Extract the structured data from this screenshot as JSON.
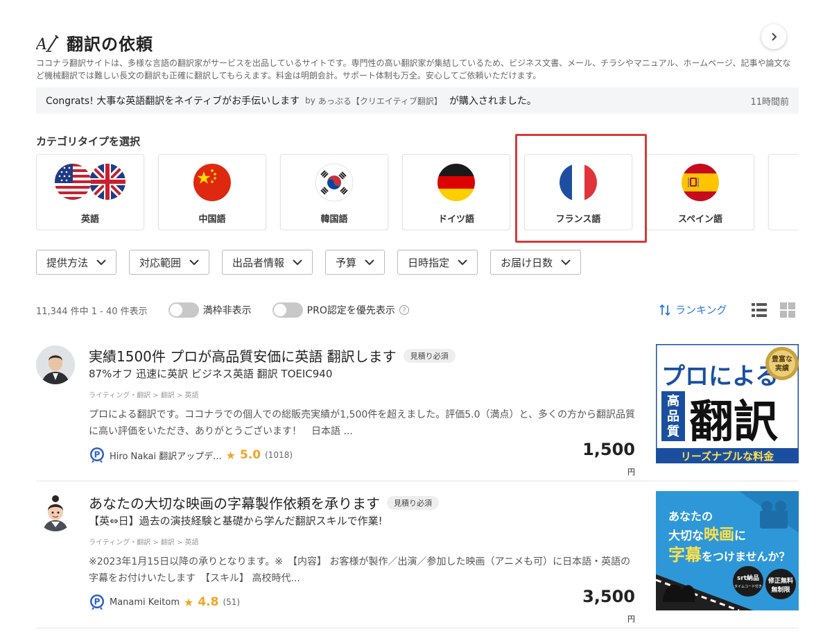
{
  "header": {
    "title": "翻訳の依頼",
    "description": "ココナラ翻訳サイトは、多様な言語の翻訳家がサービスを出品しているサイトです。専門性の高い翻訳家が集結しているため、ビジネス文書、メール、チラシやマニュアル、ホームページ、記事や論文など機械翻訳では難しい長文の翻訳も正確に翻訳してもらえます。料金は明朗会計。サポート体制も万全。安心してご依頼いただけます。"
  },
  "congrats": {
    "message": "Congrats! 大事な英語翻訳をネイティブがお手伝いします",
    "by": "by",
    "seller": "あっぷる【クリエイティブ翻訳】",
    "suffix": "が購入されました。",
    "time": "11時間前"
  },
  "categories": {
    "heading": "カテゴリタイプを選択",
    "items": [
      {
        "label": "英語",
        "icon": "us-uk-flag-icon"
      },
      {
        "label": "中国語",
        "icon": "china-flag-icon"
      },
      {
        "label": "韓国語",
        "icon": "korea-flag-icon"
      },
      {
        "label": "ドイツ語",
        "icon": "germany-flag-icon"
      },
      {
        "label": "フランス語",
        "icon": "france-flag-icon"
      },
      {
        "label": "スペイン語",
        "icon": "spain-flag-icon"
      }
    ]
  },
  "filters": [
    "提供方法",
    "対応範囲",
    "出品者情報",
    "予算",
    "日時指定",
    "お届け日数"
  ],
  "results": {
    "count": "11,344 件中 1 - 40 件表示",
    "toggle1": "満枠非表示",
    "toggle2": "PRO認定を優先表示",
    "ranking": "ランキング"
  },
  "listings": [
    {
      "title": "実績1500件 プロが高品質安価に英語 翻訳します",
      "badge": "見積り必須",
      "subtitle": "87%オフ 迅速に英訳 ビジネス英語 翻訳 TOEIC940",
      "breadcrumb": "ライティング・翻訳 > 翻訳 > 英語",
      "description": "プロによる翻訳です。ココナラでの個人での総販売実績が1,500件を超えました。評価5.0（満点）と、多くの方から翻訳品質に高い評価をいただき、ありがとうございます！　日本語 ...",
      "seller": "Hiro Nakai 翻訳アップデ...",
      "rating": "5.0",
      "reviews": "(1018)",
      "price": "1,500",
      "yen": "円",
      "thumb": {
        "badge1": "豊富な",
        "badge2": "実績",
        "line1": "プロによる",
        "vertical": [
          "高",
          "品",
          "質"
        ],
        "big": "翻訳",
        "footer": "リーズナブルな料金"
      }
    },
    {
      "title": "あなたの大切な映画の字幕製作依頼を承ります",
      "badge": "見積り必須",
      "subtitle": "【英⇔日】過去の演技経験と基礎から学んだ翻訳スキルで作業!",
      "breadcrumb": "ライティング・翻訳 > 翻訳 > 英語",
      "description": "※2023年1月15日以降の承りとなります。※　【内容】 お客様が製作／出演／参加した映画（アニメも可）に日本語・英語の字幕をお付けいたします　【スキル】 高校時代...",
      "seller": "Manami Keitom",
      "rating": "4.8",
      "reviews": "(51)",
      "price": "3,500",
      "yen": "円",
      "thumb": {
        "line1": "あなたの",
        "line2a": "大切な",
        "line2b": "映画",
        "line2c": "に",
        "line3a": "字幕",
        "line3b": "をつけませんか？",
        "tag1a": "srt納品",
        "tag1b": "タイムコード付き",
        "tag2a": "修正無料",
        "tag2b": "無制限"
      }
    }
  ],
  "colors": {
    "accent_blue": "#2a7ad8",
    "highlight_red": "#d63a3a",
    "star": "#f0a623"
  }
}
